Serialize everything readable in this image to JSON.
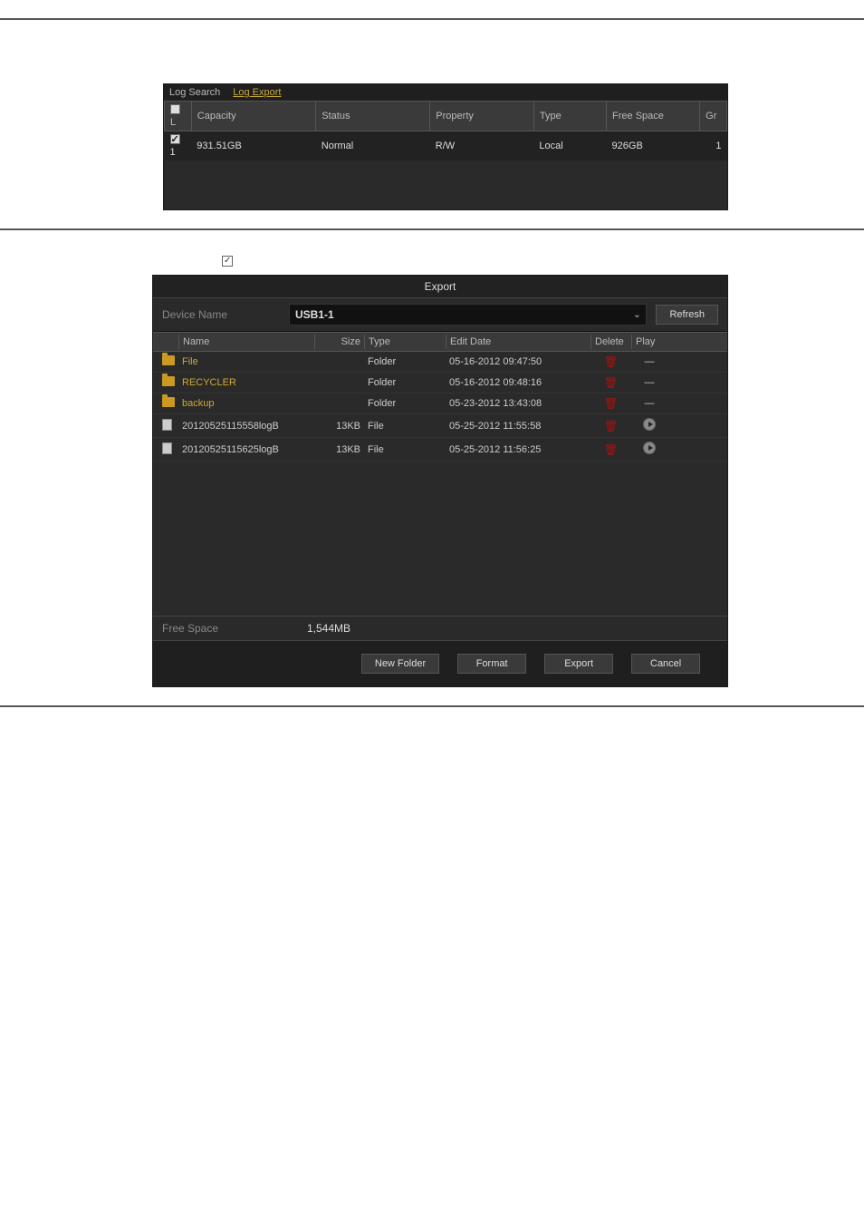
{
  "tabs": {
    "search": "Log Search",
    "export": "Log Export"
  },
  "dev_headers": {
    "capacity": "Capacity",
    "status": "Status",
    "property": "Property",
    "type": "Type",
    "free_space": "Free Space",
    "gr": "Gr"
  },
  "dev_row": {
    "idx": "1",
    "capacity": "931.51GB",
    "status": "Normal",
    "property": "R/W",
    "type": "Local",
    "free": "926GB",
    "gr": "1"
  },
  "export": {
    "title": "Export",
    "device_label": "Device Name",
    "device_value": "USB1-1",
    "refresh": "Refresh",
    "headers": {
      "name": "Name",
      "size": "Size",
      "type": "Type",
      "edit_date": "Edit Date",
      "delete": "Delete",
      "play": "Play"
    },
    "rows": [
      {
        "icon": "folder",
        "name": "File",
        "size": "",
        "type": "Folder",
        "date": "05-16-2012 09:47:50",
        "play": "dash",
        "yellow": true
      },
      {
        "icon": "folder",
        "name": "RECYCLER",
        "size": "",
        "type": "Folder",
        "date": "05-16-2012 09:48:16",
        "play": "dash",
        "yellow": true
      },
      {
        "icon": "folder",
        "name": "backup",
        "size": "",
        "type": "Folder",
        "date": "05-23-2012 13:43:08",
        "play": "dash",
        "yellow": true
      },
      {
        "icon": "file",
        "name": "20120525115558logB",
        "size": "13KB",
        "type": "File",
        "date": "05-25-2012 11:55:58",
        "play": "circle",
        "yellow": false
      },
      {
        "icon": "file",
        "name": "20120525115625logB",
        "size": "13KB",
        "type": "File",
        "date": "05-25-2012 11:56:25",
        "play": "circle",
        "yellow": false
      }
    ],
    "free_label": "Free Space",
    "free_value": "1,544MB",
    "buttons": {
      "new_folder": "New Folder",
      "format": "Format",
      "export": "Export",
      "cancel": "Cancel"
    }
  }
}
